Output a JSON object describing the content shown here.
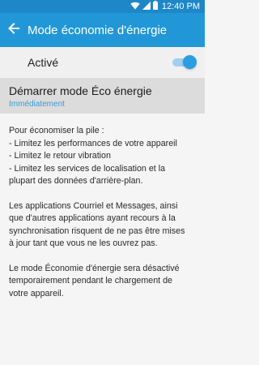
{
  "status_bar": {
    "time": "12:40 PM",
    "icons": [
      "wifi-icon",
      "signal-icon",
      "battery-icon"
    ],
    "color": "#1e87c8"
  },
  "app_bar": {
    "title": "Mode économie d'énergie",
    "back_icon": "arrow-left-icon",
    "color": "#2297d8"
  },
  "toggle": {
    "label": "Activé",
    "state": true,
    "accent": "#2a9ee0"
  },
  "eco_mode": {
    "title": "Démarrer mode Éco énergie",
    "subtitle": "Immédiatement",
    "subtitle_color": "#3b9bd6"
  },
  "description": {
    "para1": [
      "Pour économiser la pile :",
      "- Limitez les performances de votre appareil",
      "- Limitez le retour vibration",
      "- Limitez les services de localisation et la",
      "plupart des données d'arrière-plan."
    ],
    "para2": [
      "Les applications Courriel et Messages, ainsi",
      "que d'autres applications ayant recours à la",
      "synchronisation risquent de ne pas être mises",
      "à jour tant que vous ne les ouvrez pas."
    ],
    "para3": [
      "Le mode Économie d'énergie sera désactivé",
      "temporairement pendant le chargement de",
      "votre appareil."
    ]
  }
}
